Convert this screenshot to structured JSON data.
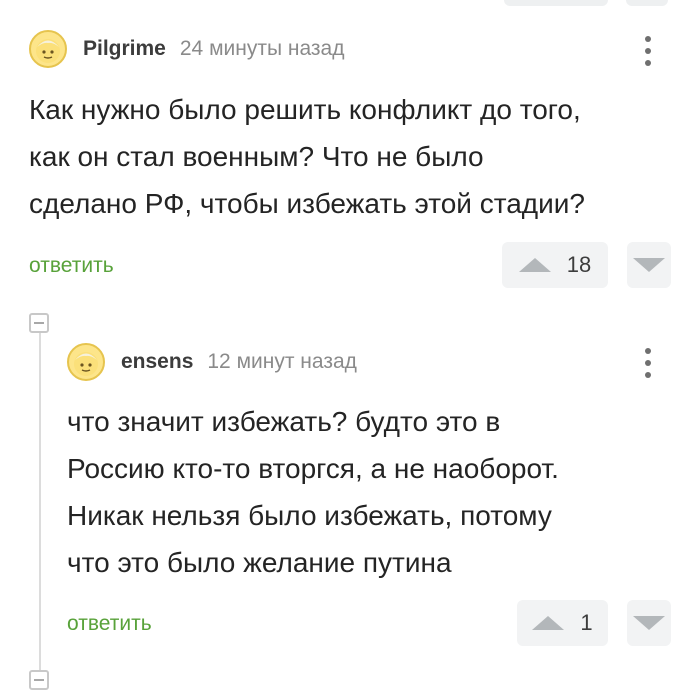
{
  "comments": [
    {
      "author": "Pilgrime",
      "time": "24 минуты назад",
      "lines": [
        "Как нужно было решить конфликт до того,",
        "как он стал военным? Что не было",
        "сделано РФ, чтобы избежать этой стадии?"
      ],
      "reply_label": "ответить",
      "votes": "18",
      "avatar_icon": "avatar-face-icon",
      "menu_icon": "more-vertical-icon"
    },
    {
      "author": "ensens",
      "time": "12 минут назад",
      "lines": [
        "что значит избежать? будто это в",
        "Россию кто-то вторгся, а не наоборот.",
        "Никак нельзя было избежать, потому",
        "что это было желание путина"
      ],
      "reply_label": "ответить",
      "votes": "1",
      "avatar_icon": "avatar-face-icon",
      "menu_icon": "more-vertical-icon"
    }
  ],
  "colors": {
    "reply_link": "#58a23a",
    "vote_bg": "#f2f3f4",
    "arrow": "#b3b7ba"
  }
}
